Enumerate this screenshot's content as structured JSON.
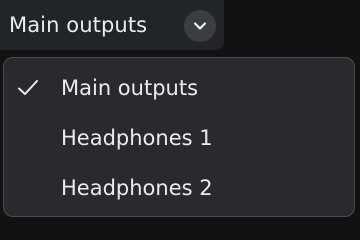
{
  "dropdown": {
    "selected_label": "Main outputs",
    "chevron_icon": "chevron-down-icon",
    "check_icon": "checkmark-icon",
    "options": [
      {
        "label": "Main outputs",
        "selected": true
      },
      {
        "label": "Headphones 1",
        "selected": false
      },
      {
        "label": "Headphones 2",
        "selected": false
      }
    ]
  }
}
